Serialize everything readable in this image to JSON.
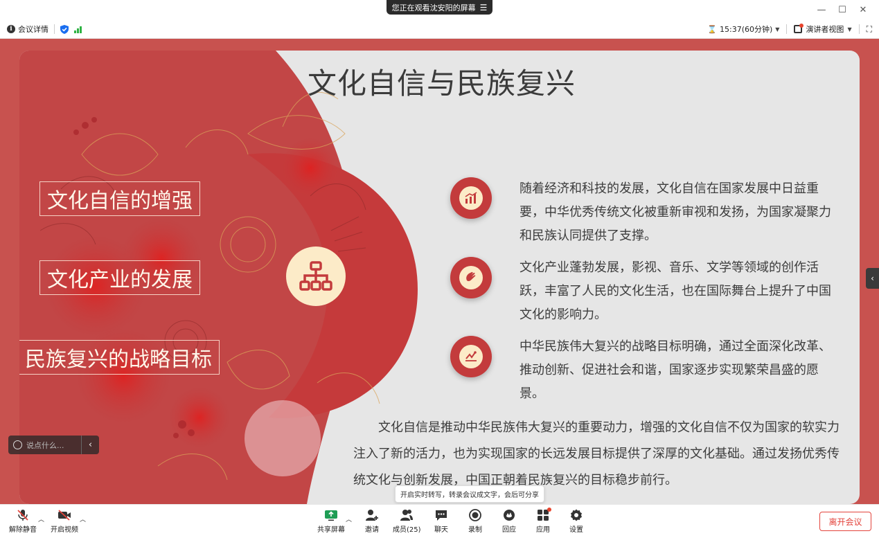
{
  "titlebar": {
    "watching_text": "您正在观看沈安阳的屏幕",
    "menu_glyph": "☰"
  },
  "window": {
    "minimize": "—",
    "maximize": "☐",
    "close": "✕"
  },
  "infobar": {
    "meeting_details": "会议详情",
    "timer": "15:37(60分钟)",
    "view_mode": "演讲者视图"
  },
  "slide": {
    "title": "文化自信与民族复兴",
    "tags": [
      "文化自信的增强",
      "文化产业的发展",
      "民族复兴的战略目标"
    ],
    "points": [
      {
        "icon": "growth-chart-icon",
        "text": "随着经济和科技的发展，文化自信在国家发展中日益重要，中华优秀传统文化被重新审视和发扬，为国家凝聚力和民族认同提供了支撑。"
      },
      {
        "icon": "clapping-hands-icon",
        "text": "文化产业蓬勃发展，影视、音乐、文学等领域的创作活跃，丰富了人民的文化生活，也在国际舞台上提升了中国文化的影响力。"
      },
      {
        "icon": "target-chart-icon",
        "text": "中华民族伟大复兴的战略目标明确，通过全面深化改革、推动创新、促进社会和谐，国家逐步实现繁荣昌盛的愿景。"
      }
    ],
    "summary": "文化自信是推动中华民族伟大复兴的重要动力，增强的文化自信不仅为国家的软实力注入了新的活力，也为实现国家的长远发展目标提供了深厚的文化基础。通过发扬优秀传统文化与创新发展，中国正朝着民族复兴的目标稳步前行。"
  },
  "comment": {
    "placeholder": "说点什么..."
  },
  "tooltip": "开启实时转写，转录会议成文字，会后可分享",
  "toolbar": {
    "unmute": "解除静音",
    "start_video": "开启视频",
    "share_screen": "共享屏幕",
    "invite": "邀请",
    "members": "成员(25)",
    "chat": "聊天",
    "record": "录制",
    "reactions": "回应",
    "apps": "应用",
    "settings": "设置",
    "leave": "离开会议"
  },
  "colors": {
    "accent_red": "#c33b3c",
    "share_bg": "#c8524f",
    "slide_bg": "#e6e6e6",
    "cream": "#fcebc8",
    "leave_red": "#e3433b"
  }
}
